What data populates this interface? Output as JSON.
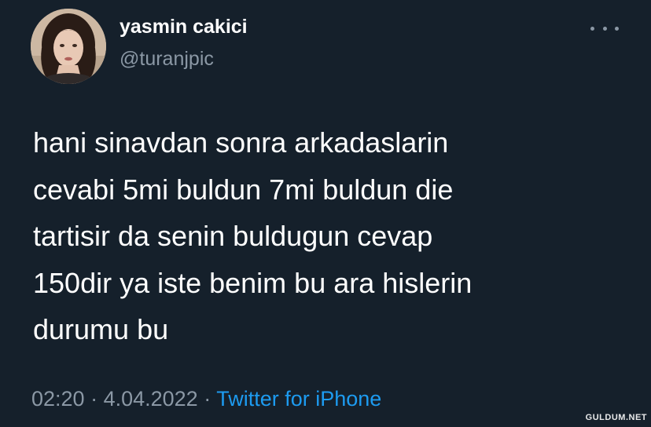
{
  "tweet": {
    "author": {
      "display_name": "yasmin cakici",
      "handle": "@turanjpic",
      "avatar_icon": "profile-photo"
    },
    "more_icon": "ellipsis-icon",
    "text_lines": [
      "hani sinavdan sonra arkadaslarin",
      "cevabi 5mi buldun 7mi buldun die",
      "tartisir da senin buldugun cevap",
      "150dir ya iste benim bu ara hislerin",
      "durumu bu"
    ],
    "time": "02:20",
    "separator": " · ",
    "date": "4.04.2022",
    "source": "Twitter for iPhone"
  },
  "watermark": "GULDUM.NET",
  "colors": {
    "background": "#15202b",
    "text": "#ffffff",
    "secondary": "#8b98a5",
    "accent": "#1d9bf0"
  }
}
